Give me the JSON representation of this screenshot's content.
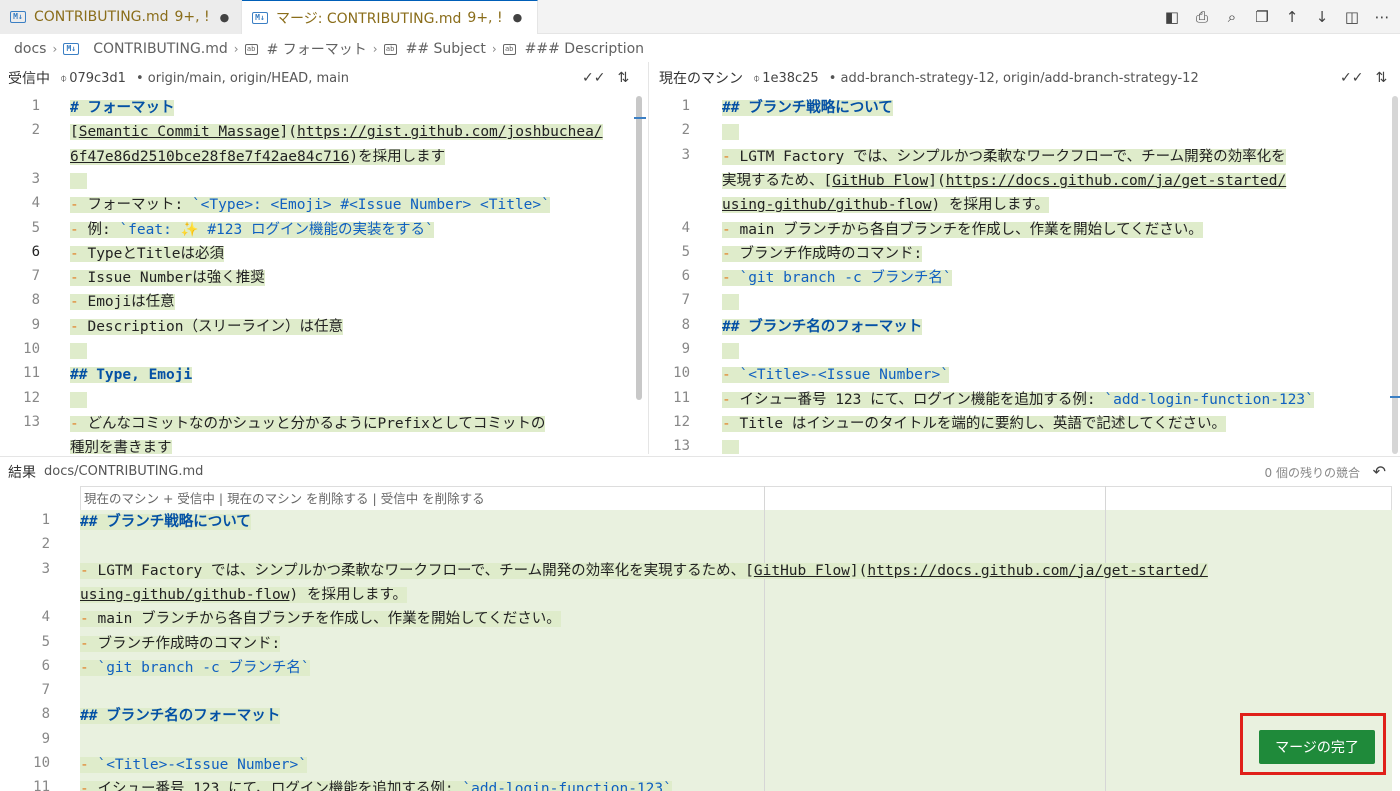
{
  "tabs": [
    {
      "icon": "M↓",
      "label": "CONTRIBUTING.md",
      "count": "9+, !",
      "dirty": "●"
    },
    {
      "icon": "M↓",
      "label": "マージ: CONTRIBUTING.md",
      "count": "9+, !",
      "dirty": "●"
    }
  ],
  "toolbar_icons": [
    "split-compare-icon",
    "print-icon",
    "search-preview-icon",
    "copy-icon",
    "arrow-up-icon",
    "arrow-down-icon",
    "split-editor-icon",
    "more-icon"
  ],
  "breadcrumb": [
    "docs",
    "CONTRIBUTING.md",
    "# フォーマット",
    "## Subject",
    "### Description"
  ],
  "incoming": {
    "title": "受信中",
    "commit": "079c3d1",
    "refs": "• origin/main, origin/HEAD, main"
  },
  "current": {
    "title": "現在のマシン",
    "commit": "1e38c25",
    "refs": "• add-branch-strategy-12, origin/add-branch-strategy-12"
  },
  "result": {
    "title": "結果",
    "path": "docs/CONTRIBUTING.md",
    "conflicts": "0 個の残りの競合",
    "codelens": "現在のマシン + 受信中 | 現在のマシン を削除する | 受信中 を削除する",
    "complete_button": "マージの完了"
  },
  "incoming_lines": [
    {
      "n": "1",
      "segs": [
        [
          "h",
          "# フォーマット"
        ]
      ]
    },
    {
      "n": "2",
      "segs": [
        [
          "",
          "["
        ],
        [
          "link",
          "Semantic Commit Massage"
        ],
        [
          "",
          "]("
        ],
        [
          "link",
          "https://gist.github.com/joshbuchea/"
        ]
      ]
    },
    {
      "n": "",
      "segs": [
        [
          "link",
          "6f47e86d2510bce28f8e7f42ae84c716"
        ],
        [
          "",
          ")を採用します"
        ]
      ]
    },
    {
      "n": "3",
      "segs": []
    },
    {
      "n": "4",
      "segs": [
        [
          "dash",
          "- "
        ],
        [
          "",
          "フォーマット: "
        ],
        [
          "code",
          "`<Type>: <Emoji> #<Issue Number> <Title>`"
        ]
      ]
    },
    {
      "n": "5",
      "segs": [
        [
          "dash",
          "- "
        ],
        [
          "",
          "例: "
        ],
        [
          "code",
          "`feat: ✨ #123 ログイン機能の実装をする`"
        ]
      ]
    },
    {
      "n": "6",
      "segs": [
        [
          "dash",
          "- "
        ],
        [
          "",
          "TypeとTitleは必須"
        ]
      ]
    },
    {
      "n": "7",
      "segs": [
        [
          "dash",
          "- "
        ],
        [
          "",
          "Issue Numberは強く推奨"
        ]
      ]
    },
    {
      "n": "8",
      "segs": [
        [
          "dash",
          "- "
        ],
        [
          "",
          "Emojiは任意"
        ]
      ]
    },
    {
      "n": "9",
      "segs": [
        [
          "dash",
          "- "
        ],
        [
          "",
          "Description（スリーライン）は任意"
        ]
      ]
    },
    {
      "n": "10",
      "segs": []
    },
    {
      "n": "11",
      "segs": [
        [
          "h",
          "## Type, Emoji"
        ]
      ]
    },
    {
      "n": "12",
      "segs": []
    },
    {
      "n": "13",
      "segs": [
        [
          "dash",
          "- "
        ],
        [
          "",
          "どんなコミットなのかシュッと分かるようにPrefixとしてコミットの"
        ]
      ]
    },
    {
      "n": "",
      "segs": [
        [
          "",
          "種別を書きます"
        ]
      ]
    }
  ],
  "current_lines": [
    {
      "n": "1",
      "segs": [
        [
          "h",
          "## ブランチ戦略について"
        ]
      ]
    },
    {
      "n": "2",
      "segs": []
    },
    {
      "n": "3",
      "segs": [
        [
          "dash",
          "- "
        ],
        [
          "",
          "LGTM Factory では、シンプルかつ柔軟なワークフローで、チーム開発の効率化を"
        ]
      ]
    },
    {
      "n": "",
      "segs": [
        [
          "",
          "実現するため、["
        ],
        [
          "link",
          "GitHub Flow"
        ],
        [
          "",
          "]("
        ],
        [
          "link",
          "https://docs.github.com/ja/get-started/"
        ]
      ]
    },
    {
      "n": "",
      "segs": [
        [
          "link",
          "using-github/github-flow"
        ],
        [
          "",
          ") を採用します。"
        ]
      ]
    },
    {
      "n": "4",
      "segs": [
        [
          "dash",
          "- "
        ],
        [
          "",
          "main ブランチから各自ブランチを作成し、作業を開始してください。"
        ]
      ]
    },
    {
      "n": "5",
      "segs": [
        [
          "dash",
          "- "
        ],
        [
          "",
          "ブランチ作成時のコマンド:"
        ]
      ]
    },
    {
      "n": "6",
      "segs": [
        [
          "dash",
          "  - "
        ],
        [
          "code",
          "`git branch -c ブランチ名`"
        ]
      ]
    },
    {
      "n": "7",
      "segs": []
    },
    {
      "n": "8",
      "segs": [
        [
          "h",
          "## ブランチ名のフォーマット"
        ]
      ]
    },
    {
      "n": "9",
      "segs": []
    },
    {
      "n": "10",
      "segs": [
        [
          "dash",
          "- "
        ],
        [
          "code",
          "`<Title>-<Issue Number>`"
        ]
      ]
    },
    {
      "n": "11",
      "segs": [
        [
          "dash",
          "- "
        ],
        [
          "",
          "イシュー番号 123 にて、ログイン機能を追加する例: "
        ],
        [
          "code",
          "`add-login-function-123`"
        ]
      ]
    },
    {
      "n": "12",
      "segs": [
        [
          "dash",
          "- "
        ],
        [
          "",
          "Title はイシューのタイトルを端的に要約し、英語で記述してください。"
        ]
      ]
    },
    {
      "n": "13",
      "segs": []
    }
  ],
  "result_lines": [
    {
      "n": "1",
      "segs": [
        [
          "h",
          "## ブランチ戦略について"
        ]
      ]
    },
    {
      "n": "2",
      "segs": []
    },
    {
      "n": "3",
      "segs": [
        [
          "dash",
          "- "
        ],
        [
          "",
          "LGTM Factory では、シンプルかつ柔軟なワークフローで、チーム開発の効率化を実現するため、["
        ],
        [
          "link",
          "GitHub Flow"
        ],
        [
          "",
          "]("
        ],
        [
          "link",
          "https://docs.github.com/ja/get-started/"
        ]
      ]
    },
    {
      "n": "",
      "segs": [
        [
          "link",
          "using-github/github-flow"
        ],
        [
          "",
          ") を採用します。"
        ]
      ]
    },
    {
      "n": "4",
      "segs": [
        [
          "dash",
          "- "
        ],
        [
          "",
          "main ブランチから各自ブランチを作成し、作業を開始してください。"
        ]
      ]
    },
    {
      "n": "5",
      "segs": [
        [
          "dash",
          "- "
        ],
        [
          "",
          "ブランチ作成時のコマンド:"
        ]
      ]
    },
    {
      "n": "6",
      "segs": [
        [
          "dash",
          "  - "
        ],
        [
          "code",
          "`git branch -c ブランチ名`"
        ]
      ]
    },
    {
      "n": "7",
      "segs": []
    },
    {
      "n": "8",
      "segs": [
        [
          "h",
          "## ブランチ名のフォーマット"
        ]
      ]
    },
    {
      "n": "9",
      "segs": []
    },
    {
      "n": "10",
      "segs": [
        [
          "dash",
          "- "
        ],
        [
          "code",
          "`<Title>-<Issue Number>`"
        ]
      ]
    },
    {
      "n": "11",
      "segs": [
        [
          "dash",
          "- "
        ],
        [
          "",
          "イシュー番号 123 にて、ログイン機能を追加する例: "
        ],
        [
          "code",
          "`add-login-function-123`"
        ]
      ]
    }
  ]
}
